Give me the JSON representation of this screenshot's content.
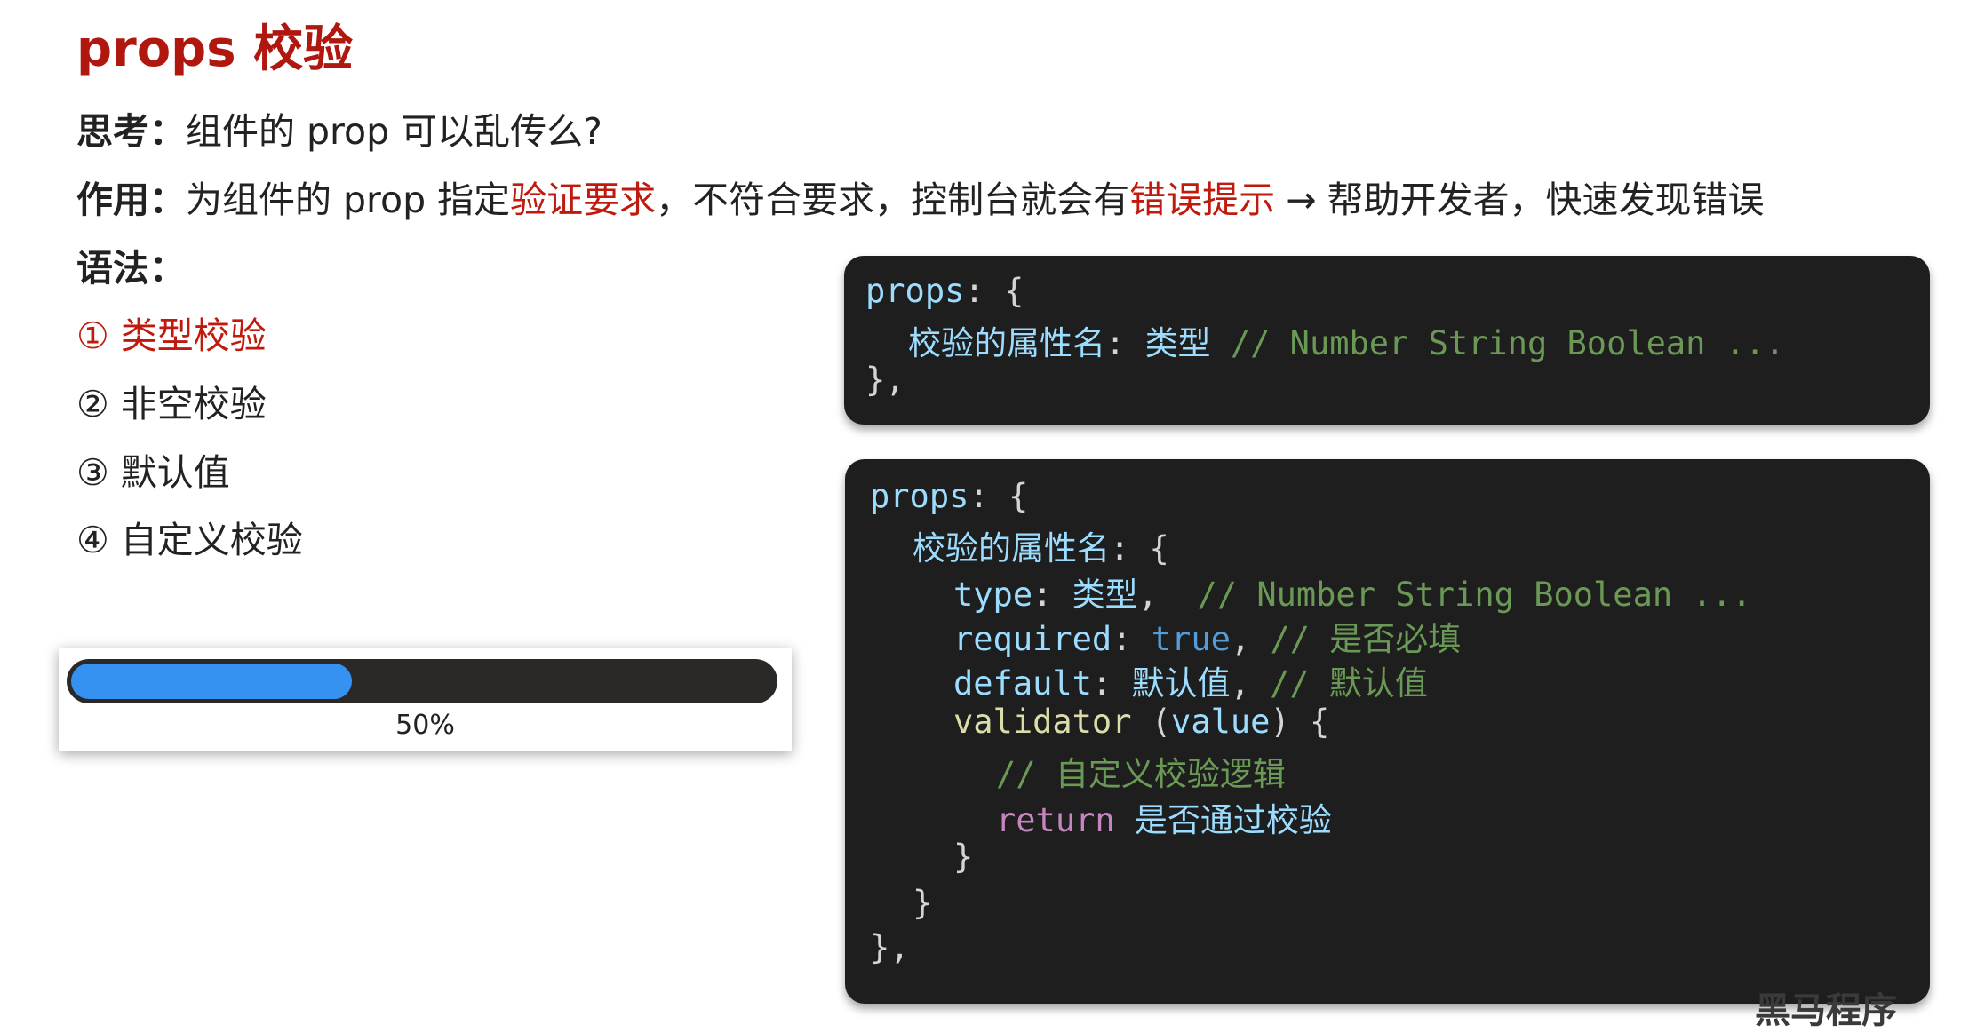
{
  "title": "props 校验",
  "think": {
    "label": "思考：",
    "text": "组件的 prop 可以乱传么?"
  },
  "purpose": {
    "label": "作用：",
    "part1": "为组件的 prop 指定",
    "highlight1": "验证要求",
    "part2": "，不符合要求，控制台就会有",
    "highlight2": "错误提示",
    "arrow": "→",
    "part3": "帮助开发者，快速发现错误"
  },
  "syntax_label": "语法：",
  "list": [
    "① 类型校验",
    "② 非空校验",
    "③ 默认值",
    "④ 自定义校验"
  ],
  "progress": {
    "value": 0.5,
    "label": "50%"
  },
  "code1": {
    "l1_prop": "props",
    "l1_punc": ": {",
    "l2_name": "校验的属性名",
    "l2_punc": ": ",
    "l2_type": "类型",
    "l2_cmt": " // Number String Boolean ...",
    "l3": "},"
  },
  "code2": {
    "l1_prop": "props",
    "l1_punc": ": {",
    "l2_name": "校验的属性名",
    "l2_punc": ": {",
    "l3_key": "type",
    "l3_punc": ": ",
    "l3_val": "类型",
    "l3_comma": ",  ",
    "l3_cmt": "// Number String Boolean ...",
    "l4_key": "required",
    "l4_punc": ": ",
    "l4_val": "true",
    "l4_comma": ", ",
    "l4_cmt": "// 是否必填",
    "l5_key": "default",
    "l5_punc": ": ",
    "l5_val": "默认值",
    "l5_comma": ", ",
    "l5_cmt": "// 默认值",
    "l6_fn": "validator",
    "l6_punc1": " (",
    "l6_arg": "value",
    "l6_punc2": ") {",
    "l7_cmt": "// 自定义校验逻辑",
    "l8_kw": "return",
    "l8_txt": " 是否通过校验",
    "l9": "}",
    "l10": "}",
    "l11": "},"
  },
  "watermark": "黑马程序"
}
